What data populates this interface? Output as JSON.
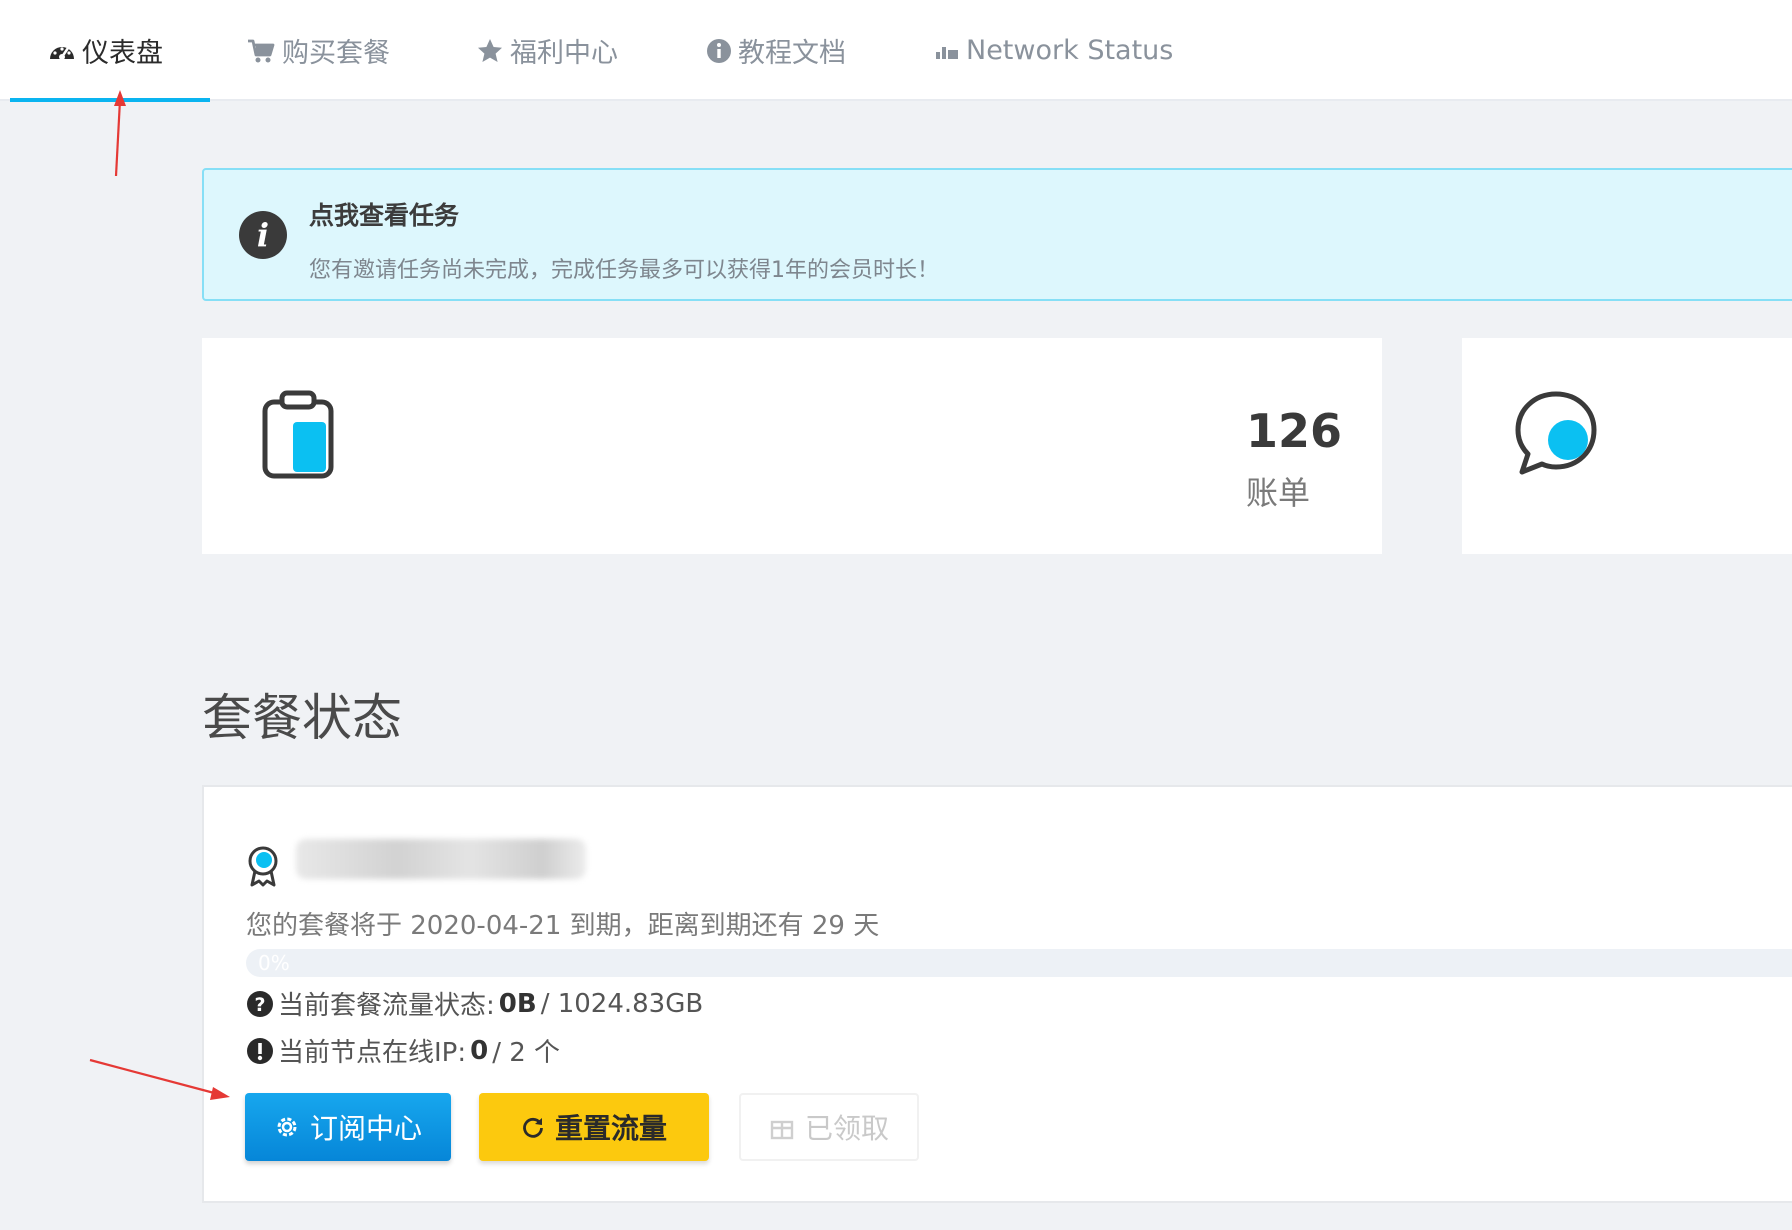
{
  "nav": {
    "items": [
      {
        "label": "仪表盘",
        "icon": "dashboard-icon",
        "active": true
      },
      {
        "label": "购买套餐",
        "icon": "cart-icon",
        "active": false
      },
      {
        "label": "福利中心",
        "icon": "star-icon",
        "active": false
      },
      {
        "label": "教程文档",
        "icon": "info-circle-icon",
        "active": false
      },
      {
        "label": "Network Status",
        "icon": "signal-icon",
        "active": false
      }
    ]
  },
  "alert": {
    "title": "点我查看任务",
    "text": "您有邀请任务尚未完成，完成任务最多可以获得1年的会员时长！",
    "icon": "info-circle-icon"
  },
  "stats": [
    {
      "value": "126",
      "label": "账单",
      "icon": "clipboard-icon"
    },
    {
      "icon": "chat-bubble-icon"
    }
  ],
  "plan": {
    "section_title": "套餐状态",
    "expire_text": "您的套餐将于 2020-04-21 到期，距离到期还有 29 天",
    "progress_percent": 0,
    "progress_label": "0%",
    "traffic_label": "当前套餐流量状态:",
    "traffic_used": "0B",
    "traffic_total": "/ 1024.83GB",
    "ip_label": "当前节点在线IP:",
    "ip_online": "0",
    "ip_total": "/ 2 个",
    "buttons": {
      "subscribe": "订阅中心",
      "reset": "重置流量",
      "claimed": "已领取"
    }
  },
  "colors": {
    "accent": "#0ab4f0",
    "alert_bg": "#ddf7fd",
    "primary_button": "#0a8fdf",
    "warning_button": "#fcc90e",
    "annotation_arrow": "#e53935"
  }
}
